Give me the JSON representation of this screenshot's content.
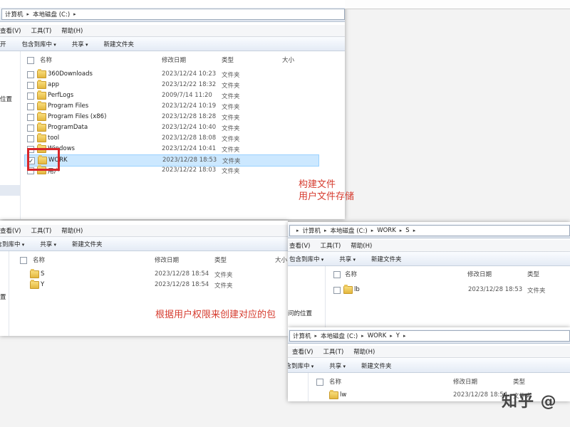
{
  "labels": {
    "computer": "计算机",
    "local_disk_c": "本地磁盘 (C:)",
    "work": "WORK",
    "s": "S",
    "y": "Y",
    "view_menu": "查看(V)",
    "tools_menu": "工具(T)",
    "help_menu": "帮助(H)",
    "open": "开",
    "include_in_library": "包含到库中",
    "share": "共享",
    "new_folder": "新建文件夹",
    "col_name": "名称",
    "col_modified": "修改日期",
    "col_type": "类型",
    "col_size": "大小",
    "left_location": "位置",
    "left_recent": "问的位置",
    "left_fragment": "置"
  },
  "main_rows": [
    {
      "name": "360Downloads",
      "date": "2023/12/24 10:23",
      "type": "文件夹"
    },
    {
      "name": "app",
      "date": "2023/12/22 18:32",
      "type": "文件夹"
    },
    {
      "name": "PerfLogs",
      "date": "2009/7/14 11:20",
      "type": "文件夹"
    },
    {
      "name": "Program Files",
      "date": "2023/12/24 10:19",
      "type": "文件夹"
    },
    {
      "name": "Program Files (x86)",
      "date": "2023/12/28 18:28",
      "type": "文件夹"
    },
    {
      "name": "ProgramData",
      "date": "2023/12/24 10:40",
      "type": "文件夹"
    },
    {
      "name": "tool",
      "date": "2023/12/28 18:08",
      "type": "文件夹"
    },
    {
      "name": "Windows",
      "date": "2023/12/24 10:41",
      "type": "文件夹"
    },
    {
      "name": "WORK",
      "date": "2023/12/28 18:53",
      "type": "文件夹"
    },
    {
      "name": "用户",
      "date": "2023/12/22 18:03",
      "type": "文件夹"
    }
  ],
  "work_rows": [
    {
      "name": "S",
      "date": "2023/12/28 18:54",
      "type": "文件夹"
    },
    {
      "name": "Y",
      "date": "2023/12/28 18:54",
      "type": "文件夹"
    }
  ],
  "s_rows": [
    {
      "name": "lb",
      "date": "2023/12/28 18:53",
      "type": "文件夹"
    }
  ],
  "y_rows": [
    {
      "name": "lw",
      "date": "2023/12/28 18:54",
      "type": "文件夹"
    }
  ],
  "annotations": {
    "build_files_line1": "构建文件",
    "build_files_line2": "用户文件存储",
    "create_by_permission": "根据用户权限来创建对应的包"
  },
  "watermark": "知乎 @",
  "colors": {
    "annotation_red": "#d63c2f",
    "highlight_border": "#d8262a",
    "selection": "#cce8ff"
  }
}
